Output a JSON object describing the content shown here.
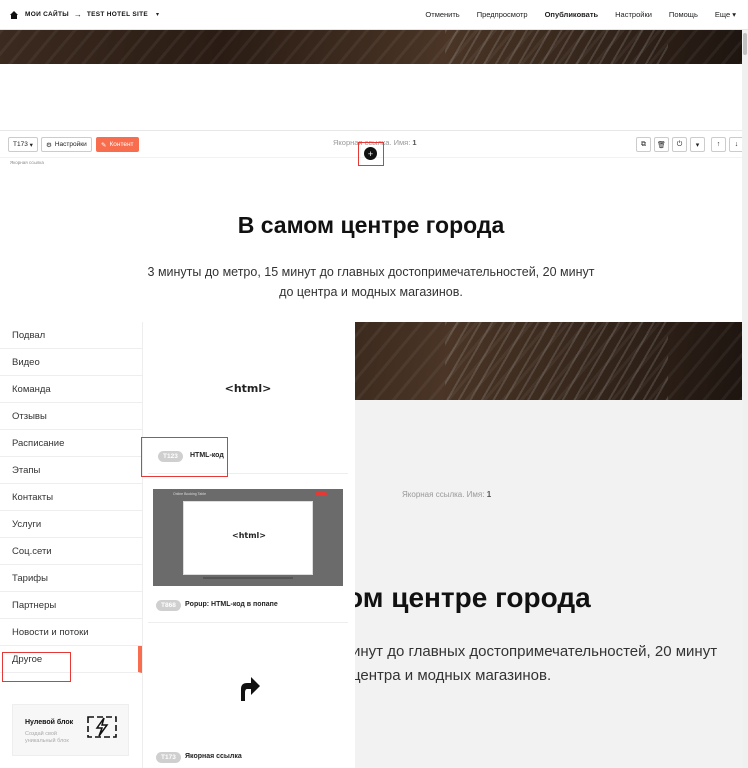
{
  "topbar": {
    "breadcrumb_root": "МОИ САЙТЫ",
    "arrow": "→",
    "site_name": "TEST HOTEL SITE",
    "caret": "▾",
    "menu": {
      "undo": "Отменить",
      "preview": "Предпросмотр",
      "publish": "Опубликовать",
      "settings": "Настройки",
      "help": "Помощь",
      "more": "Еще ▾"
    }
  },
  "block_toolbar": {
    "block_code": "T173",
    "settings_label": "Настройки",
    "content_label": "Контент",
    "anchor_prefix": "Якорная ссылка. Имя:",
    "anchor_name": "1",
    "plus": "+",
    "small_anchor": "Якорная ссылка",
    "icons": [
      "copy-icon",
      "trash-icon",
      "power-icon",
      "dropdown-icon",
      "arrow-up-icon",
      "arrow-down-icon"
    ]
  },
  "content": {
    "title": "В самом центре города",
    "subtitle_line1": "3 минуты до метро, 15 минут до главных достопримечательностей, 20 минут",
    "subtitle_line2": "до центра и модных магазинов."
  },
  "lower": {
    "anchor_prefix": "Якорная ссылка. Имя:",
    "anchor_name": "1",
    "title": "ом центре города",
    "sub_line1": "инут до главных достопримечательностей, 20 минут",
    "sub_line2": "центра и модных магазинов."
  },
  "categories": [
    {
      "label": "Подвал"
    },
    {
      "label": "Видео"
    },
    {
      "label": "Команда"
    },
    {
      "label": "Отзывы"
    },
    {
      "label": "Расписание"
    },
    {
      "label": "Этапы"
    },
    {
      "label": "Контакты"
    },
    {
      "label": "Услуги"
    },
    {
      "label": "Соц.сети"
    },
    {
      "label": "Тарифы"
    },
    {
      "label": "Партнеры"
    },
    {
      "label": "Новости и потоки"
    },
    {
      "label": "Другое",
      "active": true
    }
  ],
  "zero_block": {
    "title": "Нулевой блок",
    "subtitle": "Создай свой уникальный блок"
  },
  "blocks": [
    {
      "preview": "<html>",
      "code": "T123",
      "name": "HTML-код"
    },
    {
      "preview": "<html>",
      "code": "T868",
      "name": "Popup: HTML-код в попапе",
      "popup_title": "Online Booking Table"
    },
    {
      "code": "T173",
      "name": "Якорная ссылка"
    }
  ],
  "colors": {
    "accent": "#f86d4e",
    "highlight": "#e53935"
  }
}
